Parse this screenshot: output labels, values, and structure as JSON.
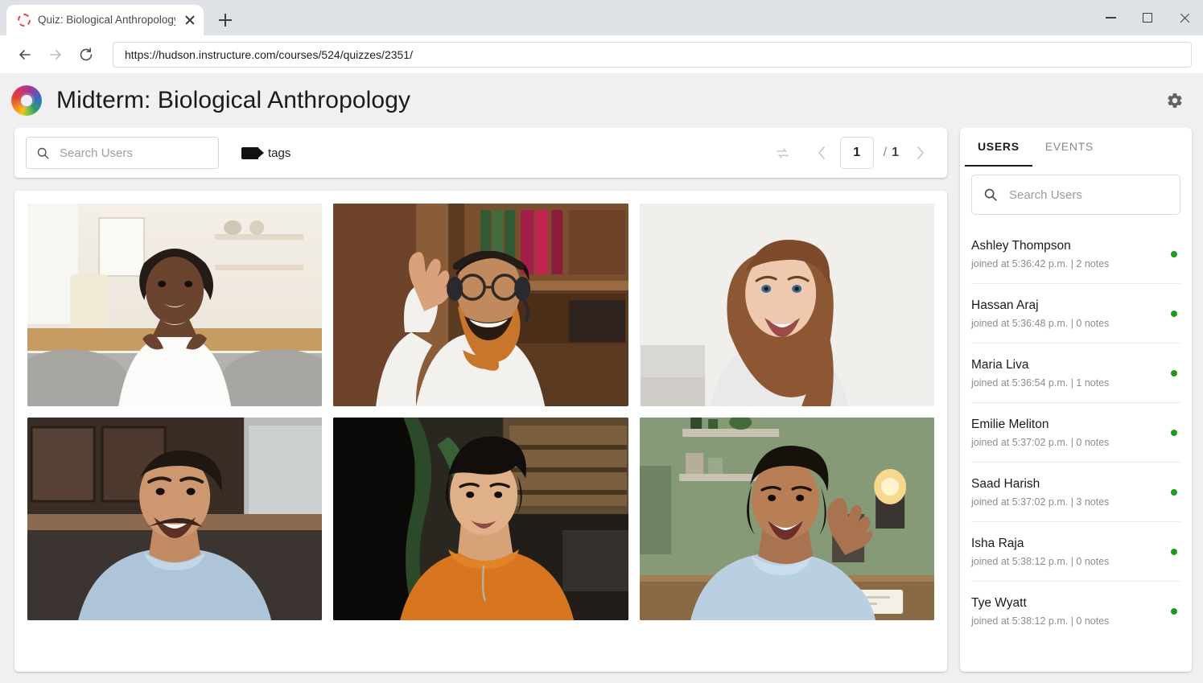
{
  "browser": {
    "tab": {
      "title": "Quiz: Biological Anthropology",
      "favicon": "loading-circle-icon"
    },
    "new_tab_label": "+",
    "back_icon": "back-arrow-icon",
    "forward_icon": "forward-arrow-icon",
    "reload_icon": "reload-icon",
    "url": "https://hudson.instructure.com/courses/524/quizzes/2351/",
    "window": {
      "minimize": "minimize-icon",
      "maximize": "maximize-icon",
      "close": "close-icon"
    }
  },
  "header": {
    "logo": "canvas-spiral-logo",
    "title": "Midterm: Biological Anthropology",
    "settings_icon": "gear-icon"
  },
  "toolbar": {
    "search": {
      "placeholder": "Search Users",
      "value": "",
      "icon": "search-icon"
    },
    "tags": {
      "label": "tags",
      "icon": "tag-icon"
    },
    "pagination": {
      "repeat_icon": "repeat-icon",
      "prev_icon": "chevron-left-icon",
      "next_icon": "chevron-right-icon",
      "current_page": "1",
      "separator": "/",
      "total_pages": "1"
    }
  },
  "video_grid": {
    "tiles": [
      {
        "id": "tile-1",
        "alt": "Woman in white t-shirt on grey couch in bright kitchen"
      },
      {
        "id": "tile-2",
        "alt": "Man with headphones and orange scarf waving in front of bookshelf"
      },
      {
        "id": "tile-3",
        "alt": "Woman with long auburn hair against white wall"
      },
      {
        "id": "tile-4",
        "alt": "Man in light blue shirt in dark kitchen"
      },
      {
        "id": "tile-5",
        "alt": "Person in orange sweater in dim room with plants"
      },
      {
        "id": "tile-6",
        "alt": "Woman in blue shirt waving at desk with green wall"
      }
    ]
  },
  "right_panel": {
    "tabs": [
      {
        "label": "USERS",
        "active": true
      },
      {
        "label": "EVENTS",
        "active": false
      }
    ],
    "search": {
      "placeholder": "Search Users",
      "value": "",
      "icon": "search-icon"
    },
    "status_color": "#1d9b1d",
    "users": [
      {
        "name": "Ashley Thompson",
        "meta": "joined at 5:36:42 p.m.  |  2 notes",
        "online": true
      },
      {
        "name": "Hassan Araj",
        "meta": "joined at 5:36:48 p.m.  |  0 notes",
        "online": true
      },
      {
        "name": "Maria Liva",
        "meta": "joined at 5:36:54 p.m.  |  1 notes",
        "online": true
      },
      {
        "name": "Emilie Meliton",
        "meta": "joined at 5:37:02 p.m.  |  0 notes",
        "online": true
      },
      {
        "name": "Saad Harish",
        "meta": "joined at 5:37:02 p.m.  |  3 notes",
        "online": true
      },
      {
        "name": "Isha Raja",
        "meta": "joined at 5:38:12 p.m.  |  0 notes",
        "online": true
      },
      {
        "name": "Tye Wyatt",
        "meta": "joined at 5:38:12 p.m.  |  0 notes",
        "online": true
      }
    ]
  }
}
